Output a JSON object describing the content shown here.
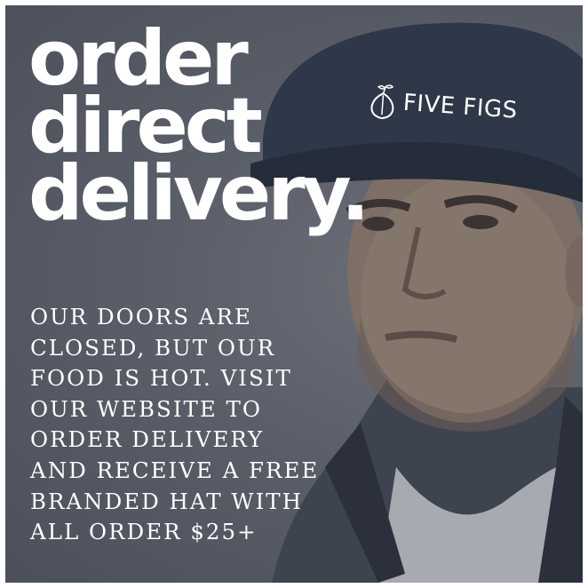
{
  "headline": {
    "line1": "order",
    "line2": "direct",
    "line3": "delivery."
  },
  "body": {
    "lines": [
      "OUR DOORS ARE",
      "CLOSED, BUT OUR",
      "FOOD IS HOT. VISIT",
      "OUR WEBSITE TO",
      "ORDER DELIVERY",
      "AND RECEIVE A FREE",
      "BRANDED HAT WITH",
      "ALL ORDER $25+"
    ]
  },
  "brand": {
    "name": "FIVE FIGS",
    "icon": "fig-icon"
  },
  "colors": {
    "overlay": "#5a5e68",
    "text": "#ffffff",
    "cap": "#2f3848"
  }
}
